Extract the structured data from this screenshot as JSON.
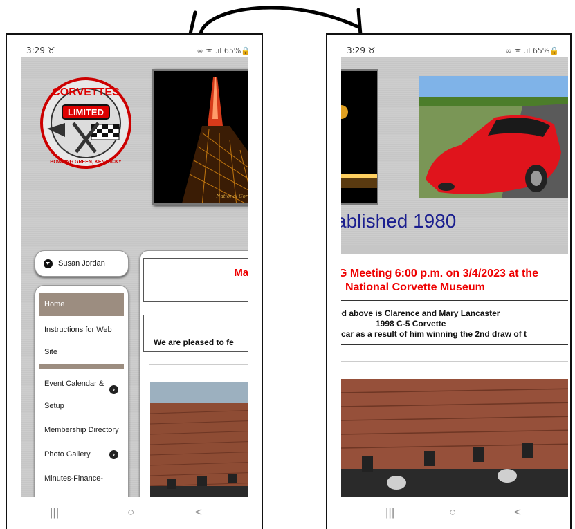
{
  "left_phone": {
    "status": {
      "time": "3:29",
      "sync_icon": "sync-icon",
      "icons_text": "65%"
    },
    "logo": {
      "top_text": "CORVETTES",
      "middle_text": "LIMITED",
      "bottom_text": "BOWLING GREEN, KENTUCKY"
    },
    "monument_caption": "National Corvette",
    "user": {
      "name": "Susan Jordan"
    },
    "menu": [
      {
        "label": "Home",
        "active": true
      },
      {
        "label": "Instructions for Web Site"
      },
      {
        "label": "Event Calendar & Setup",
        "has_submenu": true
      },
      {
        "label": "Membership Directory"
      },
      {
        "label": "Photo Gallery",
        "has_submenu": true
      },
      {
        "label": "Minutes-Finance-"
      }
    ],
    "banner_partial": "Mar",
    "message_partial": "We are pleased to fe"
  },
  "right_phone": {
    "status": {
      "time": "3:29",
      "icons_text": "65%"
    },
    "established_partial": "ablished 1980",
    "meeting_line1": "G Meeting 6:00 p.m. on 3/4/2023 at the",
    "meeting_line2": "National Corvette Museum",
    "caption_line1": "ed above is Clarence and Mary Lancaster",
    "caption_line2": "1998 C-5 Corvette",
    "caption_line3": "car as a result of him winning the 2nd draw of t"
  },
  "navbar": {
    "recent": "|||",
    "home": "○",
    "back": "<"
  },
  "colors": {
    "accent_red": "#e00000",
    "established_blue": "#1b1f8f",
    "menu_active": "#9c8d80"
  }
}
